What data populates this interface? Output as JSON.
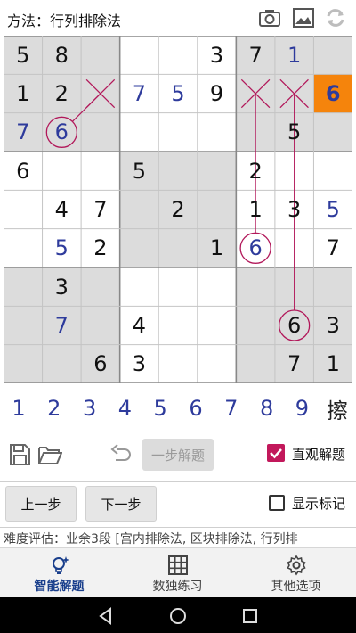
{
  "header": {
    "title": "方法：行列排除法"
  },
  "board": {
    "grid": [
      [
        "5",
        "8",
        "",
        "",
        "",
        "3",
        "7",
        "1",
        ""
      ],
      [
        "1",
        "2",
        "",
        "7",
        "5",
        "9",
        "",
        "",
        "6"
      ],
      [
        "7",
        "6",
        "",
        "",
        "",
        "",
        "",
        "5",
        ""
      ],
      [
        "6",
        "",
        "",
        "5",
        "",
        "",
        "2",
        "",
        ""
      ],
      [
        "",
        "4",
        "7",
        "",
        "2",
        "",
        "1",
        "3",
        "5"
      ],
      [
        "",
        "5",
        "2",
        "",
        "",
        "1",
        "6",
        "",
        "7"
      ],
      [
        "",
        "3",
        "",
        "",
        "",
        "",
        "",
        "",
        ""
      ],
      [
        "",
        "7",
        "",
        "4",
        "",
        "",
        "",
        "6",
        "3"
      ],
      [
        "",
        "",
        "6",
        "3",
        "",
        "",
        "",
        "7",
        "1"
      ]
    ],
    "kinds": [
      [
        "g",
        "g",
        "",
        "",
        "",
        "g",
        "g",
        "s",
        ""
      ],
      [
        "g",
        "g",
        "",
        "s",
        "s",
        "g",
        "",
        "",
        "h"
      ],
      [
        "s",
        "s",
        "",
        "",
        "",
        "",
        "",
        "g",
        ""
      ],
      [
        "g",
        "",
        "",
        "g",
        "",
        "",
        "g",
        "",
        ""
      ],
      [
        "",
        "g",
        "g",
        "",
        "g",
        "",
        "g",
        "g",
        "s"
      ],
      [
        "",
        "s",
        "g",
        "",
        "",
        "g",
        "s",
        "",
        "g"
      ],
      [
        "",
        "g",
        "",
        "",
        "",
        "",
        "",
        "",
        ""
      ],
      [
        "",
        "s",
        "",
        "g",
        "",
        "",
        "",
        "g",
        "g"
      ],
      [
        "",
        "",
        "g",
        "g",
        "",
        "",
        "",
        "g",
        "g"
      ]
    ],
    "shaded": [
      [
        1,
        1,
        1,
        0,
        0,
        0,
        1,
        1,
        1
      ],
      [
        1,
        1,
        1,
        0,
        0,
        0,
        1,
        1,
        1
      ],
      [
        1,
        1,
        1,
        0,
        0,
        0,
        1,
        1,
        1
      ],
      [
        0,
        0,
        0,
        1,
        1,
        1,
        0,
        0,
        0
      ],
      [
        0,
        0,
        0,
        1,
        1,
        1,
        0,
        0,
        0
      ],
      [
        0,
        0,
        0,
        1,
        1,
        1,
        0,
        0,
        0
      ],
      [
        1,
        1,
        1,
        0,
        0,
        0,
        1,
        1,
        1
      ],
      [
        1,
        1,
        1,
        0,
        0,
        0,
        1,
        1,
        1
      ],
      [
        1,
        1,
        1,
        0,
        0,
        0,
        1,
        1,
        1
      ]
    ],
    "highlight_cell": [
      1,
      8
    ],
    "circled_cells": [
      [
        2,
        1
      ],
      [
        5,
        6
      ],
      [
        7,
        7
      ]
    ],
    "crossed_cells": [
      [
        1,
        2
      ],
      [
        1,
        6
      ],
      [
        1,
        7
      ]
    ],
    "colors": {
      "shade": "#dcdcdc",
      "highlight": "#f5840c",
      "annotation": "#b2185a",
      "given": "#111111",
      "solved": "#2e3b9c"
    }
  },
  "numpad": {
    "keys": [
      "1",
      "2",
      "3",
      "4",
      "5",
      "6",
      "7",
      "8",
      "9"
    ],
    "erase_label": "擦"
  },
  "toolbar": {
    "save_icon": "save-icon",
    "open_icon": "folder-open-icon",
    "undo_icon": "undo-icon",
    "step_solve_label": "一步解题",
    "intuitive_label": "直观解题",
    "intuitive_checked": true
  },
  "nav": {
    "prev_label": "上一步",
    "next_label": "下一步",
    "show_marks_label": "显示标记",
    "show_marks_checked": false
  },
  "status": {
    "text": "难度评估：业余3段 [宫内排除法, 区块排除法, 行列排"
  },
  "tabs": [
    {
      "label": "智能解题",
      "icon": "lightbulb-icon",
      "active": true
    },
    {
      "label": "数独练习",
      "icon": "grid-icon",
      "active": false
    },
    {
      "label": "其他选项",
      "icon": "gear-icon",
      "active": false
    }
  ]
}
